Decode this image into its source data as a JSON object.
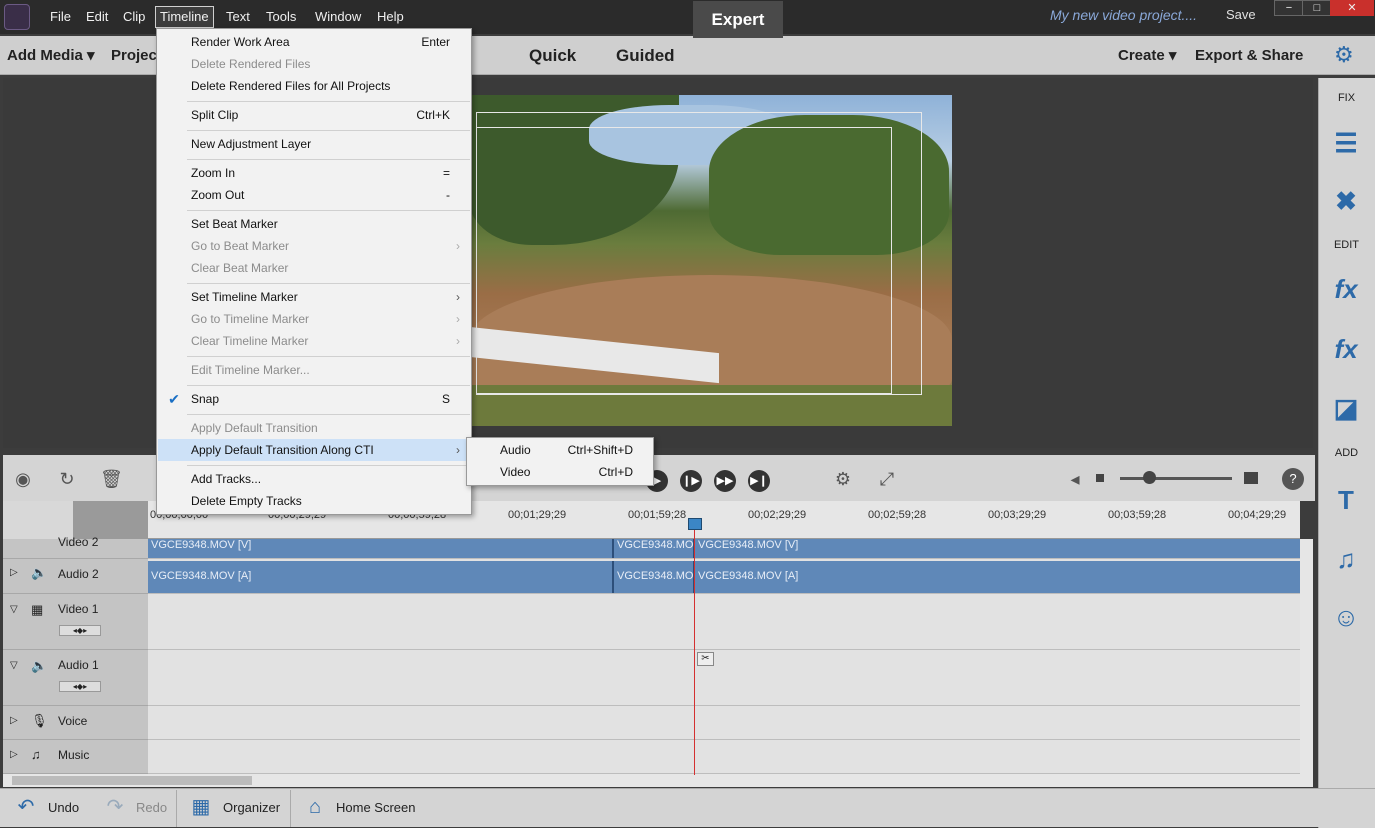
{
  "menubar": {
    "items": [
      "File",
      "Edit",
      "Clip",
      "Timeline",
      "Text",
      "Tools",
      "Window",
      "Help"
    ],
    "project_name": "My new video project....",
    "save": "Save",
    "win_minimize": "−",
    "win_maximize": "□",
    "win_close": "✕"
  },
  "modebar": {
    "add_media": "Add Media",
    "project": "Projec",
    "tabs": [
      "Quick",
      "Guided",
      "Expert"
    ],
    "create": "Create",
    "export_share": "Export & Share"
  },
  "timeline_menu": {
    "items": [
      {
        "label": "Render Work Area",
        "shortcut": "Enter"
      },
      {
        "label": "Delete Rendered Files"
      },
      {
        "label": "Delete Rendered Files for All Projects"
      },
      {
        "label": "Split Clip",
        "shortcut": "Ctrl+K"
      },
      {
        "label": "New Adjustment Layer"
      },
      {
        "label": "Zoom In",
        "shortcut": "="
      },
      {
        "label": "Zoom Out",
        "shortcut": "-"
      },
      {
        "label": "Set Beat Marker"
      },
      {
        "label": "Go to Beat Marker",
        "arrow": "›"
      },
      {
        "label": "Clear Beat Marker"
      },
      {
        "label": "Set Timeline Marker",
        "arrow": "›"
      },
      {
        "label": "Go to Timeline Marker",
        "arrow": "›"
      },
      {
        "label": "Clear Timeline Marker",
        "arrow": "›"
      },
      {
        "label": "Edit Timeline Marker..."
      },
      {
        "label": "Snap",
        "shortcut": "S"
      },
      {
        "label": "Apply Default Transition"
      },
      {
        "label": "Apply Default Transition Along CTI",
        "arrow": "›"
      },
      {
        "label": "Add Tracks..."
      },
      {
        "label": "Delete Empty Tracks"
      }
    ],
    "submenu": [
      {
        "label": "Audio",
        "shortcut": "Ctrl+Shift+D"
      },
      {
        "label": "Video",
        "shortcut": "Ctrl+D"
      }
    ]
  },
  "right_panel": {
    "fix_label": "FIX",
    "edit_label": "EDIT",
    "add_label": "ADD"
  },
  "timeline": {
    "ruler_ticks": [
      "00;00;00;00",
      "00;00;29;29",
      "00;00;59;28",
      "00;01;29;29",
      "00;01;59;28",
      "00;02;29;29",
      "00;02;59;28",
      "00;03;29;29",
      "00;03;59;28",
      "00;04;29;29"
    ],
    "tracks": [
      "Video 2",
      "Audio 2",
      "Video 1",
      "Audio 1",
      "Voice",
      "Music"
    ],
    "clips": {
      "v2_a": "VGCE9348.MOV [V]",
      "v2_b": "VGCE9348.MO",
      "v2_c": "VGCE9348.MOV [V]",
      "a2_a": "VGCE9348.MOV [A]",
      "a2_b": "VGCE9348.MO",
      "a2_c": "VGCE9348.MOV [A]"
    }
  },
  "bottombar": {
    "undo": "Undo",
    "redo": "Redo",
    "organizer": "Organizer",
    "home_screen": "Home Screen"
  },
  "colors": {
    "accent": "#2d6aa8",
    "clip": "#5f88b8",
    "cti": "#d43030"
  }
}
